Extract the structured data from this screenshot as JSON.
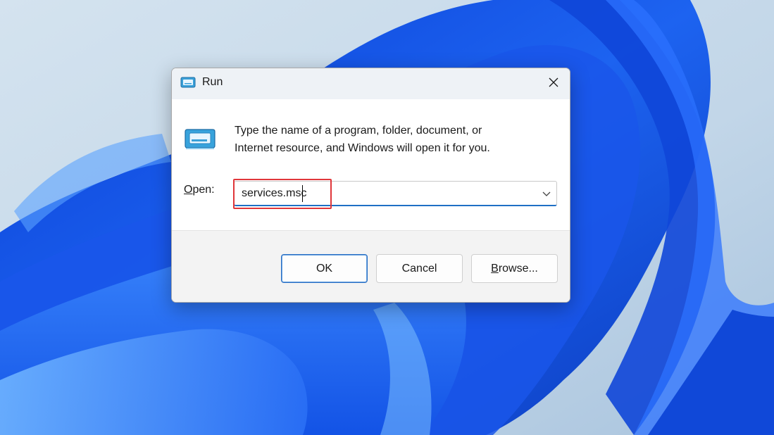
{
  "window": {
    "title": "Run",
    "close_glyph": "✕"
  },
  "dialog": {
    "description_line1": "Type the name of a program, folder, document, or",
    "description_line2": "Internet resource, and Windows will open it for you.",
    "open_label_u": "O",
    "open_label_rest": "pen:",
    "open_value": "services.msc"
  },
  "buttons": {
    "ok": "OK",
    "cancel": "Cancel",
    "browse_u": "B",
    "browse_rest": "rowse..."
  },
  "icons": {
    "title": "run-icon",
    "large": "run-icon",
    "close": "close-icon",
    "dropdown": "chevron-down-icon"
  },
  "colors": {
    "accent": "#1f6fc5",
    "highlight": "#e0363a",
    "wallpaper_blue": "#1e5fe8"
  }
}
